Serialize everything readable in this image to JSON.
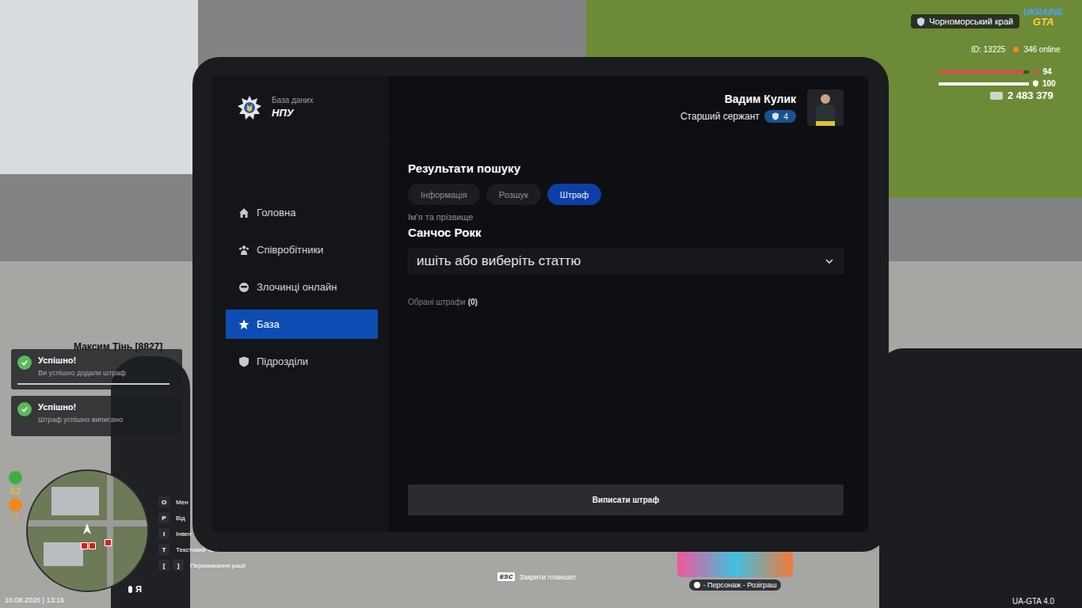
{
  "hud": {
    "region": "Чорноморський край",
    "logo": {
      "top": "UKRAINE",
      "bottom": "GTA"
    },
    "id": "ID: 13225",
    "online": "346 online",
    "health": {
      "reading": "94",
      "level": 0.94
    },
    "armor": {
      "reading": "100",
      "level": 1
    },
    "money": "2 483 379",
    "player_tag": "Максим Тінь [8827]",
    "status_icons": [
      {
        "kind": "icon",
        "text": "",
        "color": "#3fae3f"
      },
      {
        "kind": "text",
        "text": "GZ",
        "color": "#d9c23a"
      },
      {
        "kind": "icon",
        "text": "",
        "color": "#f08a1c"
      },
      {
        "kind": "text",
        "text": "0",
        "color": "#e8a33a"
      }
    ],
    "minimap": {
      "marker": "Я"
    },
    "keys": [
      {
        "keys": [
          "O"
        ],
        "label": "Мен"
      },
      {
        "keys": [
          "P"
        ],
        "label": "Від"
      },
      {
        "keys": [
          "I"
        ],
        "label": "Інвен"
      },
      {
        "keys": [
          "T"
        ],
        "label": "Текстовий чат"
      },
      {
        "keys": [
          "[",
          "]"
        ],
        "label": "Перемикання рації"
      }
    ],
    "notifications": [
      {
        "title": "Успішно!",
        "message": "Ви успішно додали штраф",
        "level": 0.96
      },
      {
        "title": "Успішно!",
        "message": "Штраф успішно виписано",
        "level": 0
      }
    ],
    "datetime": "10.08.2026 | 13:16",
    "close_hint": {
      "key": "ESC",
      "label": "Закрити планшет"
    },
    "promo": "- Персонаж - Розіграш",
    "version": "UA-GTA 4.0"
  },
  "tablet": {
    "brand": {
      "caption": "База даних",
      "title": "НПУ"
    },
    "nav": [
      {
        "label": "Головна",
        "icon": "home",
        "selected": false
      },
      {
        "label": "Співробітники",
        "icon": "people",
        "selected": false
      },
      {
        "label": "Злочинці онлайн",
        "icon": "mask",
        "selected": false
      },
      {
        "label": "База",
        "icon": "star",
        "selected": true
      },
      {
        "label": "Підрозділи",
        "icon": "shield",
        "selected": false
      }
    ],
    "user": {
      "name": "Вадим Кулик",
      "rank": "Старший сержант",
      "level": "4"
    },
    "page": {
      "title": "Результати пошуку",
      "tabs": [
        {
          "label": "Інформація",
          "selected": false
        },
        {
          "label": "Розшук",
          "selected": false
        },
        {
          "label": "Штраф",
          "selected": true
        }
      ],
      "name_label": "Ім'я та прізвище",
      "name": "Санчос Рокк",
      "article_placeholder": "ишіть або виберіть статтю",
      "selected_label": "Обрані штрафи",
      "selected_count": "(0)",
      "submit": "Виписати штраф"
    }
  }
}
